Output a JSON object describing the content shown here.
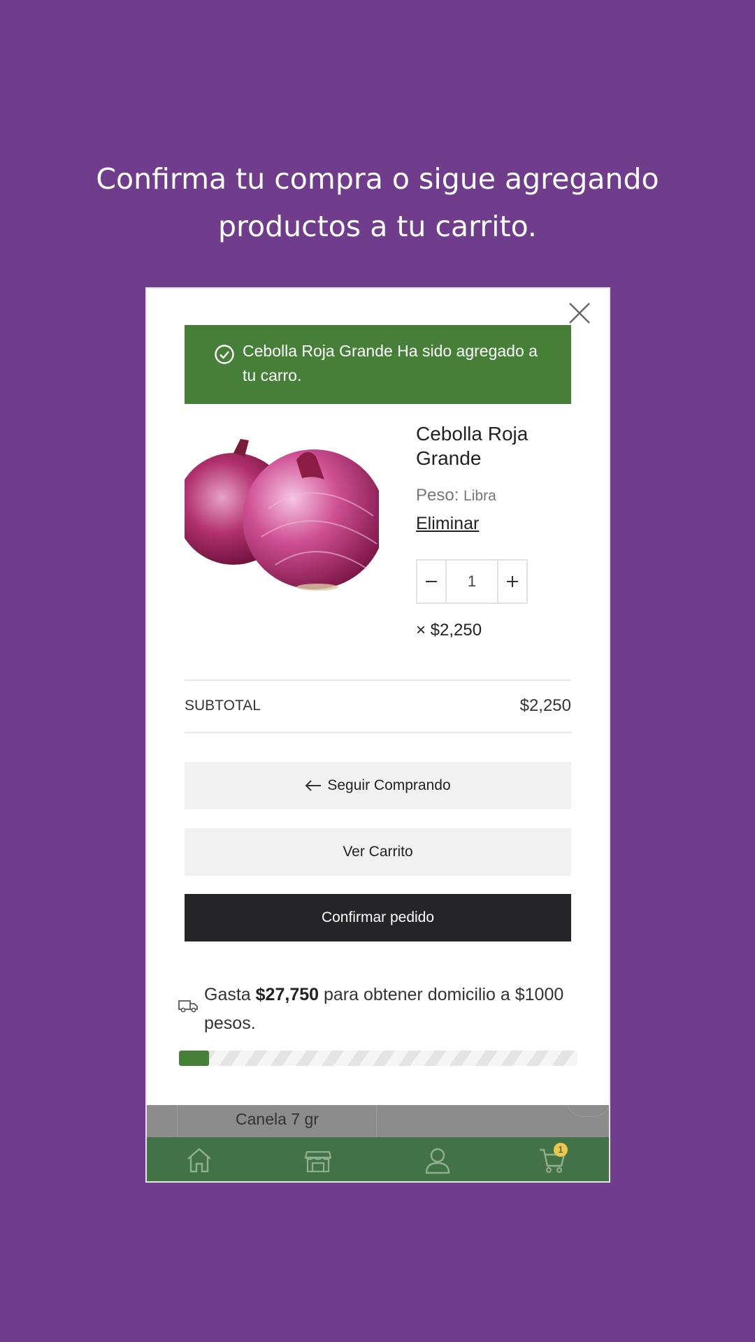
{
  "headline": {
    "line1": "Confirma tu compra o sigue agregando",
    "line2": "productos a tu carrito."
  },
  "modal": {
    "toast": {
      "message": "Cebolla Roja Grande Ha sido agregado a tu carro.",
      "icon": "check-circle-icon",
      "color": "#468038"
    },
    "product": {
      "name": "Cebolla Roja Grande",
      "weight_label": "Peso:",
      "weight_value": "Libra",
      "remove_label": "Eliminar",
      "quantity": "1",
      "price": "× $2,250"
    },
    "subtotal": {
      "label": "SUBTOTAL",
      "value": "$2,250"
    },
    "buttons": {
      "continue_shopping": "Seguir Comprando",
      "view_cart": "Ver Carrito",
      "confirm_order": "Confirmar pedido"
    },
    "shipping": {
      "prefix": "Gasta",
      "amount": "$27,750",
      "suffix": "para obtener domicilio a $1000 pesos.",
      "progress_fraction": 0.075
    }
  },
  "background_list": {
    "peek_item_label": "Canela 7 gr"
  },
  "bottom_nav": {
    "items": [
      "home-icon",
      "store-icon",
      "user-icon",
      "cart-icon"
    ],
    "cart_badge": "1",
    "color": "#437246"
  }
}
